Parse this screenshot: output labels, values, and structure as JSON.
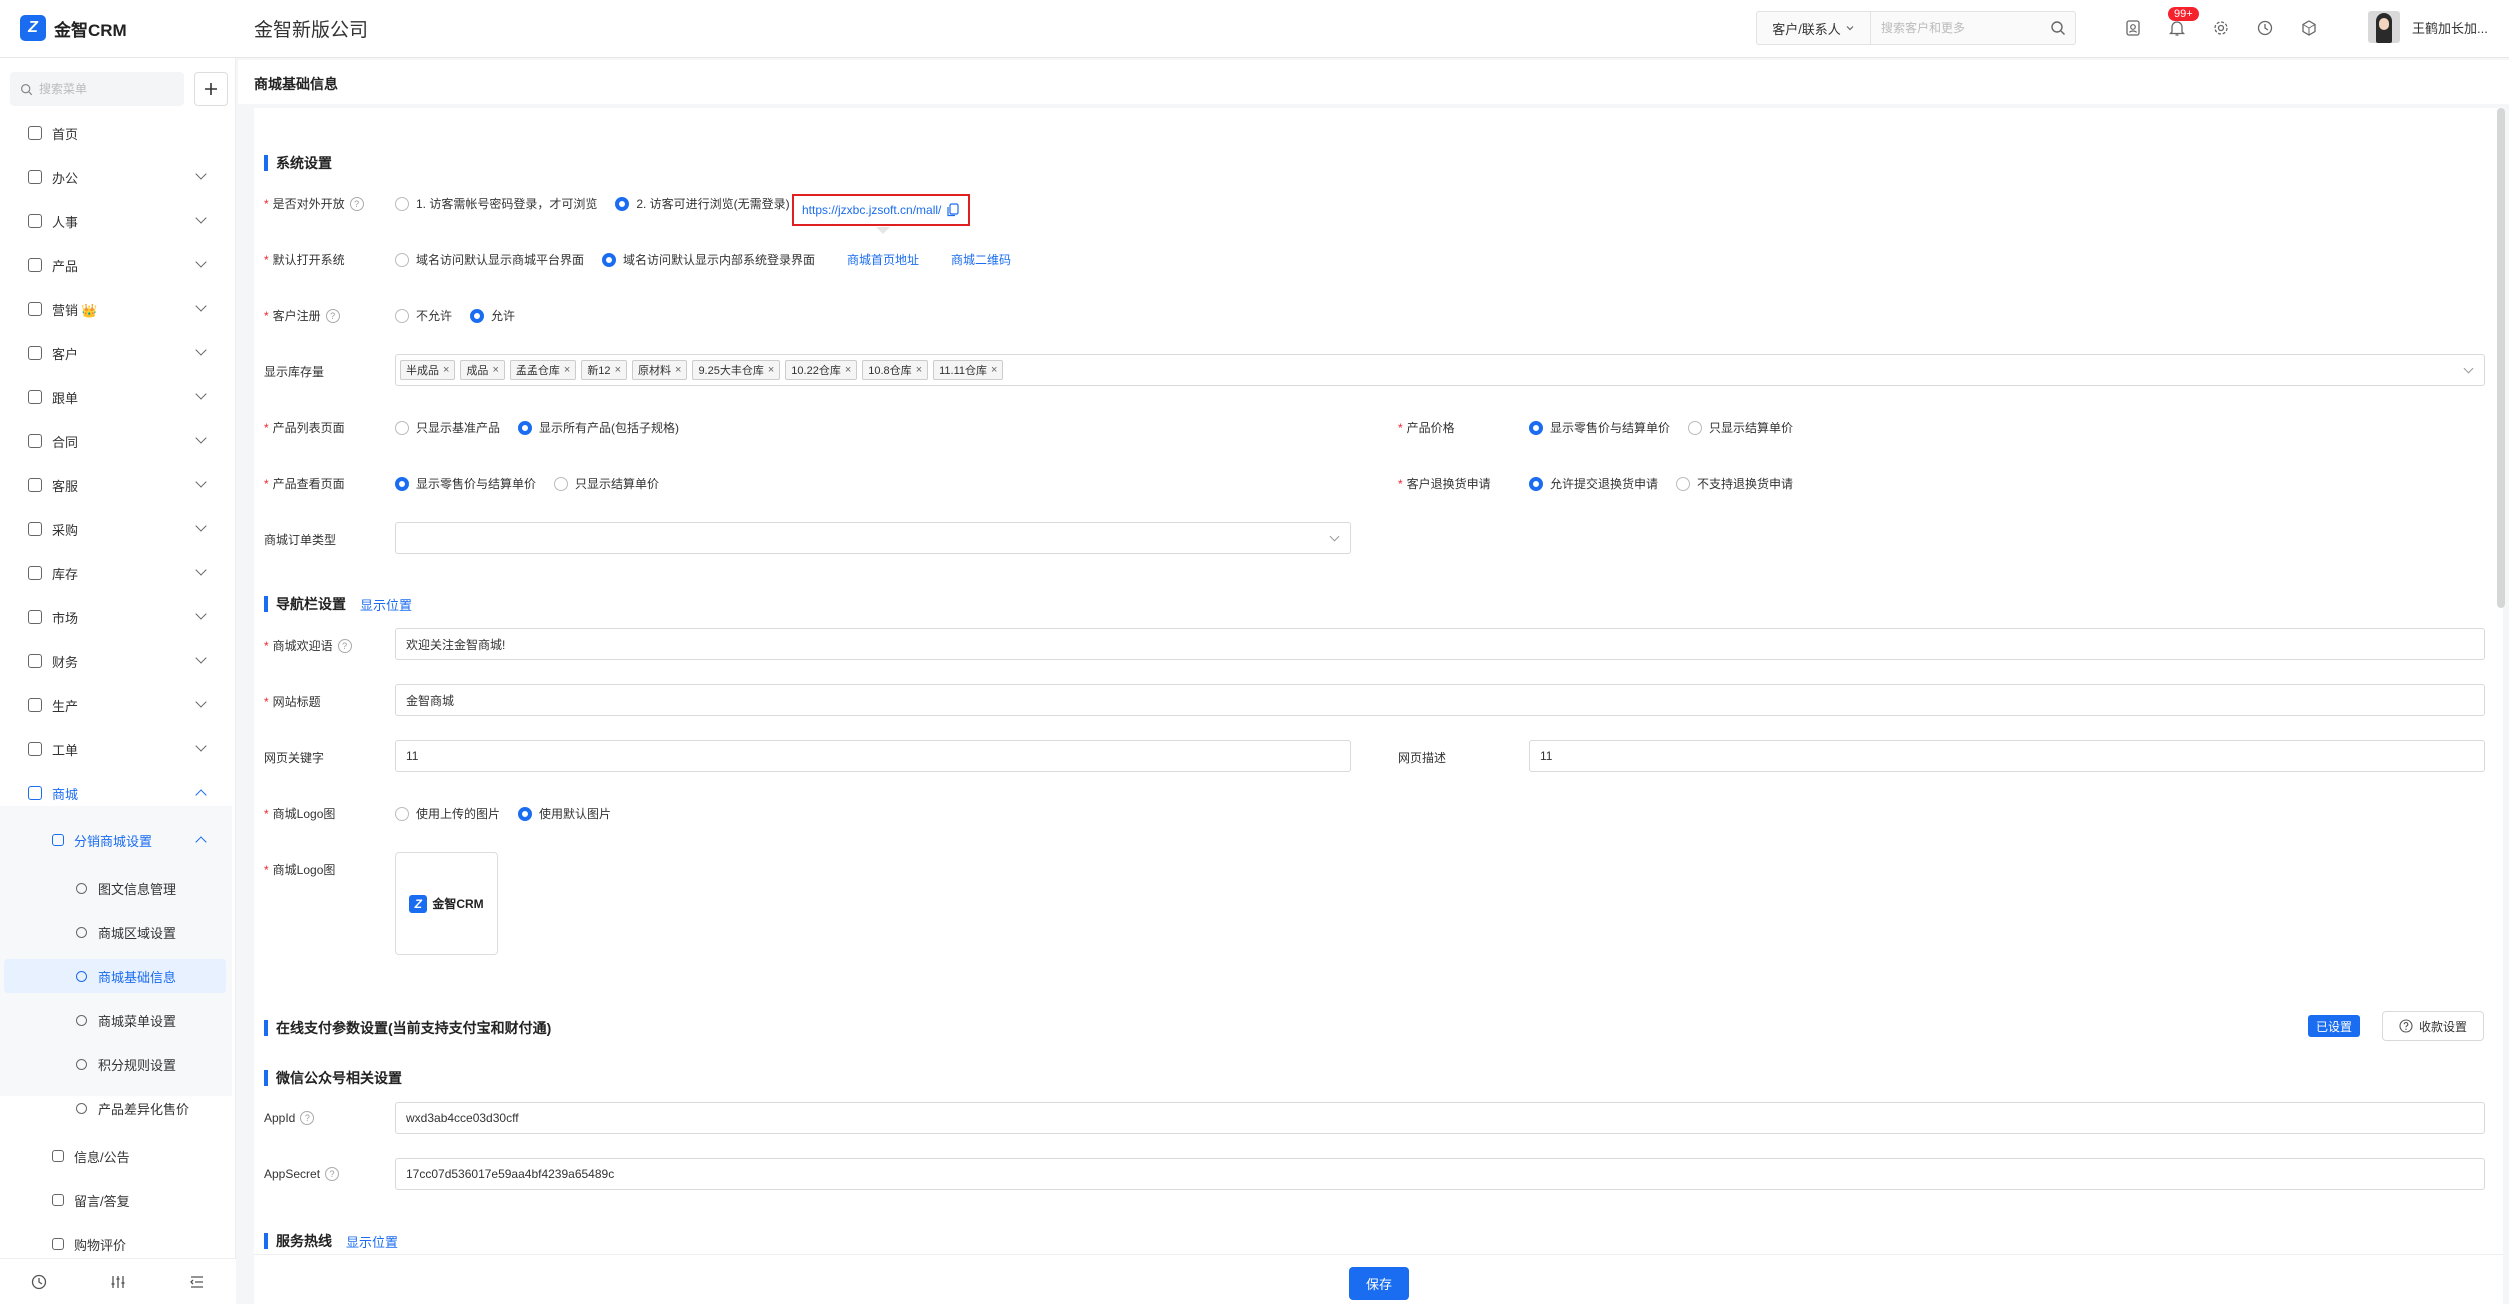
{
  "app": {
    "logo_text": "金智CRM",
    "company": "金智新版公司"
  },
  "topbar": {
    "search_select": "客户/联系人",
    "search_placeholder": "搜索客户和更多",
    "notification_count": "99+",
    "username": "王鹤加长加..."
  },
  "sidebar": {
    "search_placeholder": "搜索菜单",
    "items": [
      {
        "label": "首页",
        "icon": "home-icon"
      },
      {
        "label": "办公",
        "icon": "office-icon"
      },
      {
        "label": "人事",
        "icon": "people-icon"
      },
      {
        "label": "产品",
        "icon": "product-icon"
      },
      {
        "label": "营销",
        "icon": "marketing-icon",
        "crown": "👑"
      },
      {
        "label": "客户",
        "icon": "customer-icon"
      },
      {
        "label": "跟单",
        "icon": "followup-icon"
      },
      {
        "label": "合同",
        "icon": "contract-icon"
      },
      {
        "label": "客服",
        "icon": "service-icon"
      },
      {
        "label": "采购",
        "icon": "purchase-icon"
      },
      {
        "label": "库存",
        "icon": "inventory-icon"
      },
      {
        "label": "市场",
        "icon": "market-icon"
      },
      {
        "label": "财务",
        "icon": "finance-icon"
      },
      {
        "label": "生产",
        "icon": "production-icon"
      },
      {
        "label": "工单",
        "icon": "workorder-icon"
      },
      {
        "label": "商城",
        "icon": "mall-icon"
      }
    ],
    "sub": {
      "label": "分销商城设置"
    },
    "sub_items": [
      "图文信息管理",
      "商城区域设置",
      "商城基础信息",
      "商城菜单设置",
      "积分规则设置",
      "产品差异化售价"
    ],
    "after_items": [
      "信息/公告",
      "留言/答复",
      "购物评价"
    ]
  },
  "page": {
    "title": "商城基础信息"
  },
  "system": {
    "section_title": "系统设置",
    "open_label": "是否对外开放",
    "open_opt1": "1. 访客需帐号密码登录，才可浏览",
    "open_opt2": "2. 访客可进行浏览(无需登录)",
    "mall_url": "https://jzxbc.jzsoft.cn/mall/",
    "default_label": "默认打开系统",
    "default_opt1": "域名访问默认显示商城平台界面",
    "default_opt2": "域名访问默认显示内部系统登录界面",
    "link_home": "商城首页地址",
    "link_qr": "商城二维码",
    "reg_label": "客户注册",
    "reg_opt1": "不允许",
    "reg_opt2": "允许",
    "stock_label": "显示库存量",
    "stock_tags": [
      "半成品",
      "成品",
      "孟孟仓库",
      "新12",
      "原材料",
      "9.25大丰仓库",
      "10.22仓库",
      "10.8仓库",
      "11.11仓库"
    ],
    "list_label": "产品列表页面",
    "list_opt1": "只显示基准产品",
    "list_opt2": "显示所有产品(包括子规格)",
    "price_label": "产品价格",
    "price_opt1": "显示零售价与结算单价",
    "price_opt2": "只显示结算单价",
    "view_label": "产品查看页面",
    "view_opt1": "显示零售价与结算单价",
    "view_opt2": "只显示结算单价",
    "return_label": "客户退换货申请",
    "return_opt1": "允许提交退换货申请",
    "return_opt2": "不支持退换货申请",
    "order_type_label": "商城订单类型",
    "order_type_value": ""
  },
  "nav": {
    "section_title": "导航栏设置",
    "link": "显示位置",
    "welcome_label": "商城欢迎语",
    "welcome_value": "欢迎关注金智商城!",
    "site_title_label": "网站标题",
    "site_title_value": "金智商城",
    "keywords_label": "网页关键字",
    "keywords_value": "11",
    "desc_label": "网页描述",
    "desc_value": "11",
    "logo_label": "商城Logo图",
    "logo_opt1": "使用上传的图片",
    "logo_opt2": "使用默认图片",
    "logo_img_label": "商城Logo图",
    "logo_img_text": "金智CRM"
  },
  "payment": {
    "section_title": "在线支付参数设置(当前支持支付宝和财付通)",
    "status": "已设置",
    "btn": "收款设置"
  },
  "wechat": {
    "section_title": "微信公众号相关设置",
    "appid_label": "AppId",
    "appid_value": "wxd3ab4cce03d30cff",
    "secret_label": "AppSecret",
    "secret_value": "17cc07d536017e59aa4bf4239a65489c"
  },
  "hotline": {
    "section_title": "服务热线",
    "link": "显示位置"
  },
  "footer": {
    "save": "保存"
  },
  "colors": {
    "primary": "#1a6cf0",
    "required": "#f5222d",
    "highlight_border": "#e02020"
  }
}
